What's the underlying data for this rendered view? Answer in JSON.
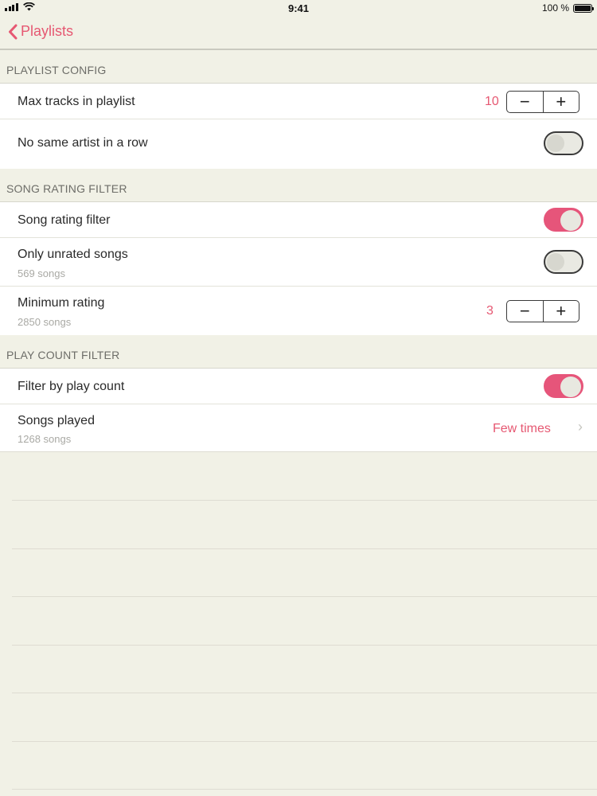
{
  "status_bar": {
    "time": "9:41",
    "battery_text": "100 %",
    "signal_icon": "signal-bars-icon",
    "wifi_icon": "wifi-icon",
    "battery_icon": "battery-icon"
  },
  "nav": {
    "back_label": "Playlists"
  },
  "sections": {
    "playlist_config": {
      "header": "PLAYLIST CONFIG",
      "max_tracks": {
        "label": "Max tracks in playlist",
        "value": "10",
        "minus": "−",
        "plus": "+"
      },
      "no_same_artist": {
        "label": "No same artist in a row",
        "on": false
      }
    },
    "song_rating": {
      "header": "SONG RATING FILTER",
      "rating_filter": {
        "label": "Song rating filter",
        "on": true
      },
      "only_unrated": {
        "label": "Only unrated songs",
        "sub": "569 songs",
        "on": false
      },
      "minimum_rating": {
        "label": "Minimum rating",
        "sub": "2850 songs",
        "value": "3",
        "minus": "−",
        "plus": "+"
      }
    },
    "play_count": {
      "header": "PLAY COUNT FILTER",
      "filter_by_play_count": {
        "label": "Filter by play count",
        "on": true
      },
      "songs_played": {
        "label": "Songs played",
        "sub": "1268 songs",
        "value": "Few times",
        "chevron": "›"
      }
    }
  },
  "colors": {
    "accent": "#e65872",
    "background": "#f1f1e6",
    "toggle_on": "#e6557a"
  }
}
